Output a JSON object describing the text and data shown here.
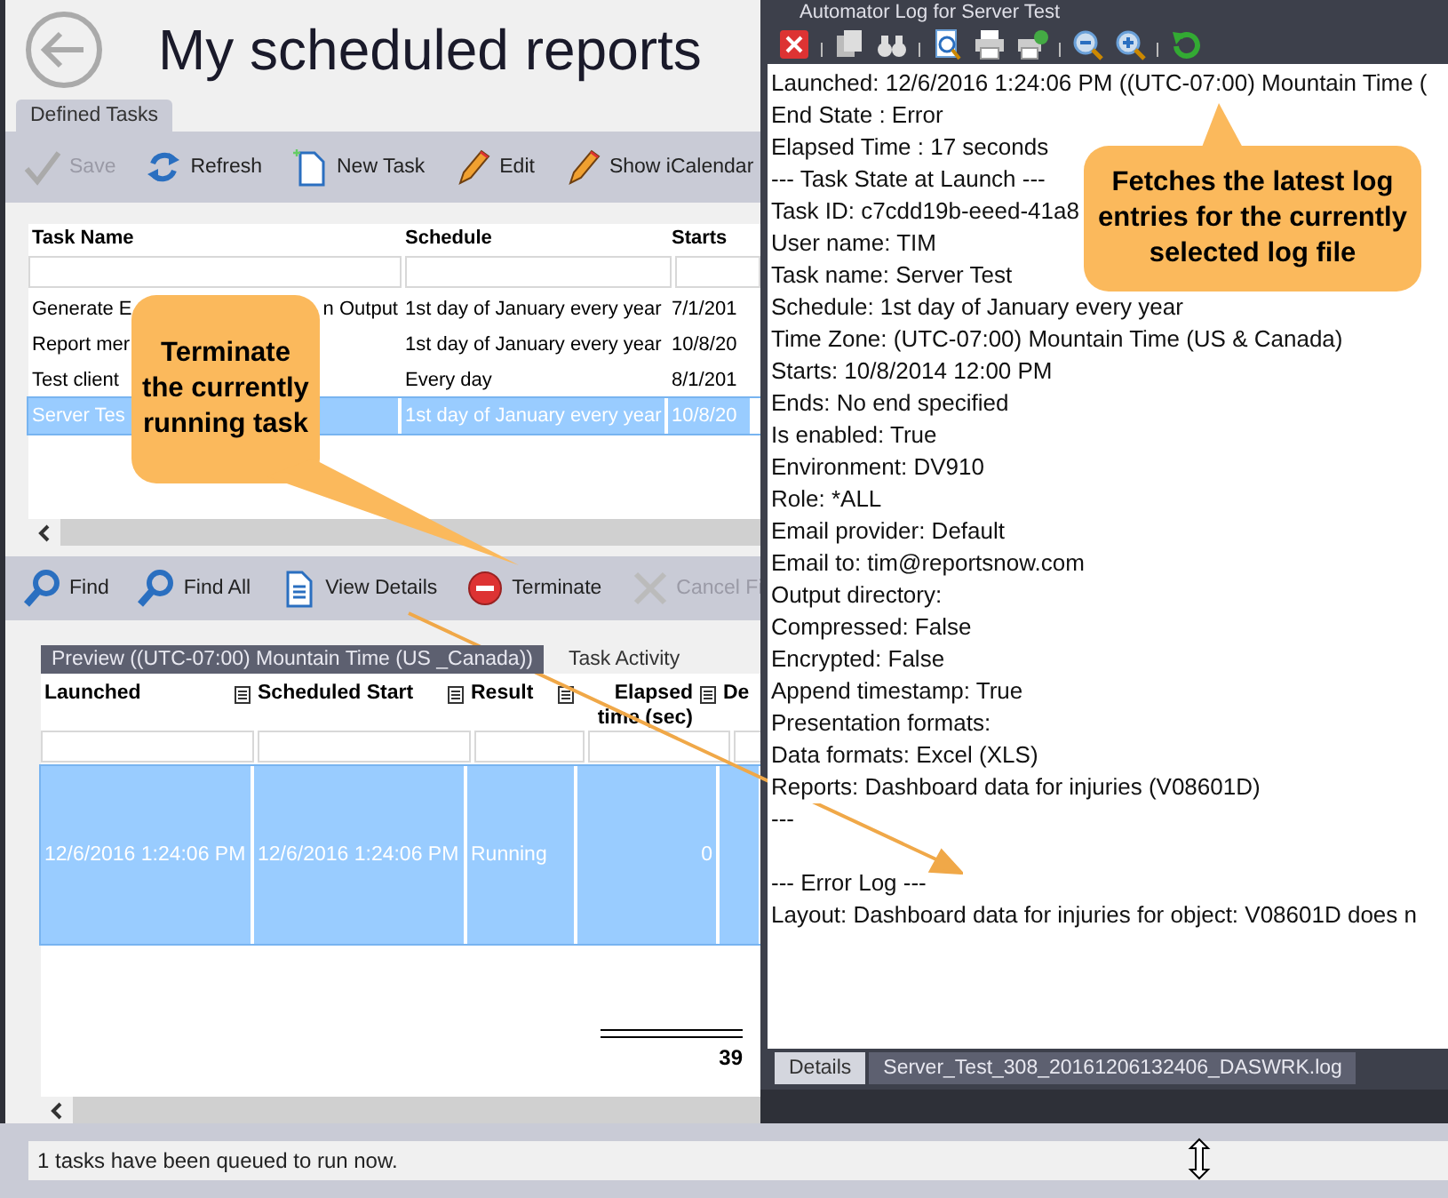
{
  "app": {
    "title": "My scheduled reports",
    "tab": "Defined Tasks",
    "toolbar": [
      {
        "label": "Save",
        "kind": "check",
        "disabled": true
      },
      {
        "label": "Refresh",
        "kind": "refresh",
        "disabled": false
      },
      {
        "label": "New Task",
        "kind": "page",
        "disabled": false
      },
      {
        "label": "Edit",
        "kind": "pencil",
        "disabled": false
      },
      {
        "label": "Show iCalendar",
        "kind": "pencil",
        "disabled": false
      }
    ],
    "tasks": {
      "columns": [
        "Task Name",
        "Schedule",
        "Starts"
      ],
      "rows": [
        {
          "cells": [
            "Generate E",
            "1st day of January every year",
            "7/1/201"
          ],
          "tail": "n Output",
          "selected": false
        },
        {
          "cells": [
            "Report mer",
            "1st day of January every year",
            "10/8/20"
          ],
          "selected": false
        },
        {
          "cells": [
            "Test client",
            "Every day",
            "8/1/201"
          ],
          "selected": false
        },
        {
          "cells": [
            "Server Tes",
            "1st day of January every year",
            "10/8/20"
          ],
          "selected": true
        }
      ]
    },
    "toolbar2": [
      {
        "label": "Find",
        "kind": "magnifier",
        "disabled": false
      },
      {
        "label": "Find All",
        "kind": "magnifier",
        "disabled": false
      },
      {
        "label": "View Details",
        "kind": "document",
        "disabled": false
      },
      {
        "label": "Terminate",
        "kind": "stop",
        "disabled": false
      },
      {
        "label": "Cancel Fi",
        "kind": "cross",
        "disabled": true
      }
    ],
    "tabs": [
      {
        "label": "Preview ((UTC-07:00) Mountain Time (US _Canada))",
        "selected": true
      },
      {
        "label": "Task Activity",
        "selected": false
      }
    ],
    "activity": {
      "columns": [
        "Launched",
        "Scheduled Start",
        "Result",
        "Elapsed time (sec)",
        "De"
      ],
      "rows": [
        {
          "cells": [
            "12/6/2016 1:24:06 PM",
            "12/6/2016 1:24:06 PM",
            "Running",
            "0"
          ],
          "selected": true
        }
      ],
      "total": "39"
    },
    "status_bar": "1 tasks have been queued to run now."
  },
  "log_window": {
    "title": "Automator Log for Server Test",
    "lines": [
      "Launched: 12/6/2016 1:24:06 PM ((UTC-07:00) Mountain Time (",
      "End State : Error",
      "Elapsed Time : 17 seconds",
      "--- Task State at Launch ---",
      "Task ID: c7cdd19b-eeed-41a8",
      "User name: TIM",
      "Task name: Server Test",
      "Schedule: 1st day of January every year",
      "Time Zone: (UTC-07:00) Mountain Time (US & Canada)",
      "Starts: 10/8/2014 12:00 PM",
      "Ends: No end specified",
      "Is enabled: True",
      "Environment: DV910",
      "Role: *ALL",
      "Email provider: Default",
      "Email to: tim@reportsnow.com",
      "Output directory:",
      "Compressed: False",
      "Encrypted: False",
      "Append timestamp: True",
      "Presentation formats:",
      "Data formats: Excel (XLS)",
      "Reports: Dashboard data for injuries (V08601D)",
      "---"
    ],
    "error_lines": [
      "--- Error Log ---",
      "Layout: Dashboard data for injuries for object: V08601D does n"
    ],
    "tabs": [
      {
        "label": "Details",
        "selected": false
      },
      {
        "label": "Server_Test_308_20161206132406_DASWRK.log",
        "selected": true
      }
    ]
  },
  "callouts": [
    {
      "text": "Terminate the currently running task"
    },
    {
      "text": "Fetches the latest log entries for the currently selected log file"
    }
  ]
}
